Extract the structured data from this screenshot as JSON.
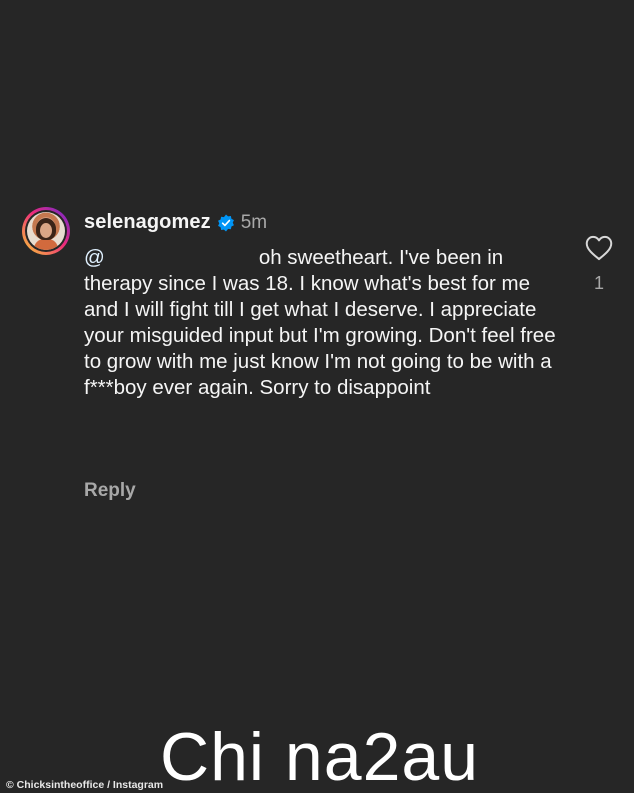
{
  "comment": {
    "username": "selenagomez",
    "time_ago": "5m",
    "mention": "@",
    "text": "oh sweetheart. I've been in therapy since I was 18. I know what's best for me and I will fight till I get what I deserve. I appreciate your misguided input but I'm growing. Don't feel free to grow with me just know I'm not going to be with a f***boy ever again. Sorry to disappoint",
    "reply_label": "Reply",
    "like_count": "1"
  },
  "icons": {
    "verified": "verified-badge-icon",
    "like": "heart-icon",
    "avatar": "avatar"
  },
  "colors": {
    "background": "#262626",
    "verified_blue": "#0095f6",
    "muted_text": "#a8a8a8"
  },
  "footer": {
    "credit": "© Chicksintheoffice / Instagram",
    "watermark": "Chi na2au"
  }
}
